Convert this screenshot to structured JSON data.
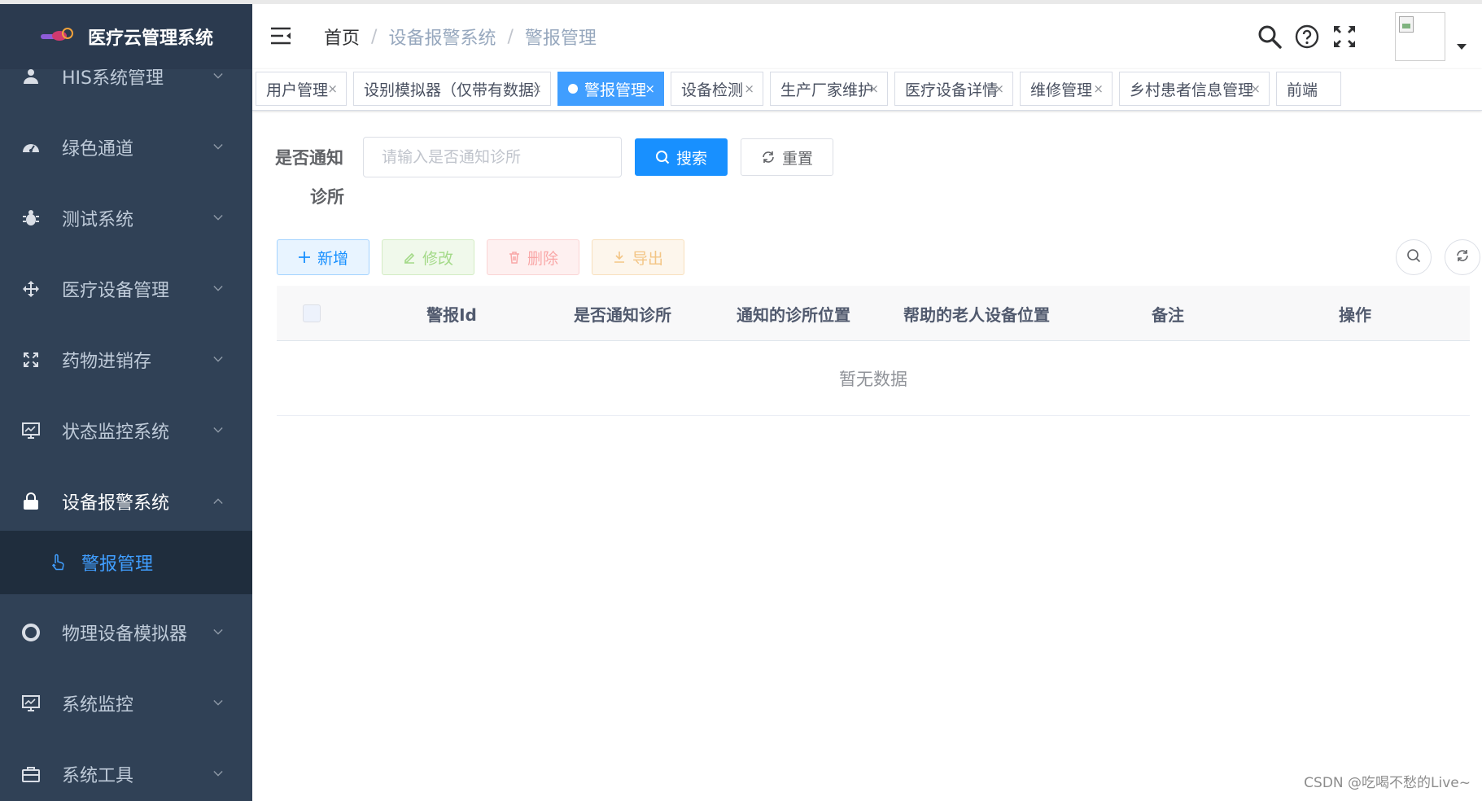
{
  "app": {
    "title": "医疗云管理系统"
  },
  "sidebar": {
    "items": [
      {
        "label": "HIS系统管理",
        "icon": "peoples-icon"
      },
      {
        "label": "绿色通道",
        "icon": "dashboard-icon"
      },
      {
        "label": "测试系统",
        "icon": "bug-icon"
      },
      {
        "label": "医疗设备管理",
        "icon": "move-arrows-icon"
      },
      {
        "label": "药物进销存",
        "icon": "fullscreen-corners-icon"
      },
      {
        "label": "状态监控系统",
        "icon": "monitor-icon"
      },
      {
        "label": "设备报警系统",
        "icon": "lock-icon"
      },
      {
        "label": "物理设备模拟器",
        "icon": "lifebuoy-icon"
      },
      {
        "label": "系统监控",
        "icon": "monitor-icon"
      },
      {
        "label": "系统工具",
        "icon": "toolbox-icon"
      }
    ],
    "open_index": 6,
    "sub_item": {
      "label": "警报管理",
      "icon": "finger-pointer-icon"
    }
  },
  "navbar": {
    "breadcrumb": [
      "首页",
      "设备报警系统",
      "警报管理"
    ],
    "separator": "/",
    "icons": [
      "search-icon",
      "question-icon",
      "fullscreen-icon"
    ]
  },
  "tags": [
    {
      "label": "用户管理",
      "close": "×"
    },
    {
      "label": "设别模拟器（仅带有数据）",
      "close": "×"
    },
    {
      "label": "警报管理",
      "close": "×",
      "active": true
    },
    {
      "label": "设备检测",
      "close": "×"
    },
    {
      "label": "生产厂家维护",
      "close": "×"
    },
    {
      "label": "医疗设备详情",
      "close": "×"
    },
    {
      "label": "维修管理",
      "close": "×"
    },
    {
      "label": "乡村患者信息管理",
      "close": "×"
    },
    {
      "label": "前端",
      "close": ""
    }
  ],
  "search_form": {
    "label_line1": "是否通知",
    "label_line2": "诊所",
    "placeholder": "请输入是否通知诊所",
    "value": "",
    "search_label": "搜索",
    "reset_label": "重置"
  },
  "toolbar": {
    "add_label": "新增",
    "edit_label": "修改",
    "delete_label": "删除",
    "export_label": "导出"
  },
  "table": {
    "columns": [
      "警报Id",
      "是否通知诊所",
      "通知的诊所位置",
      "帮助的老人设备位置",
      "备注",
      "操作"
    ],
    "rows": [],
    "empty_text": "暂无数据"
  },
  "watermark": "CSDN @吃喝不愁的Live~",
  "colors": {
    "sidebar_bg": "#304156",
    "active_blue": "#409eff",
    "primary": "#1890ff"
  }
}
